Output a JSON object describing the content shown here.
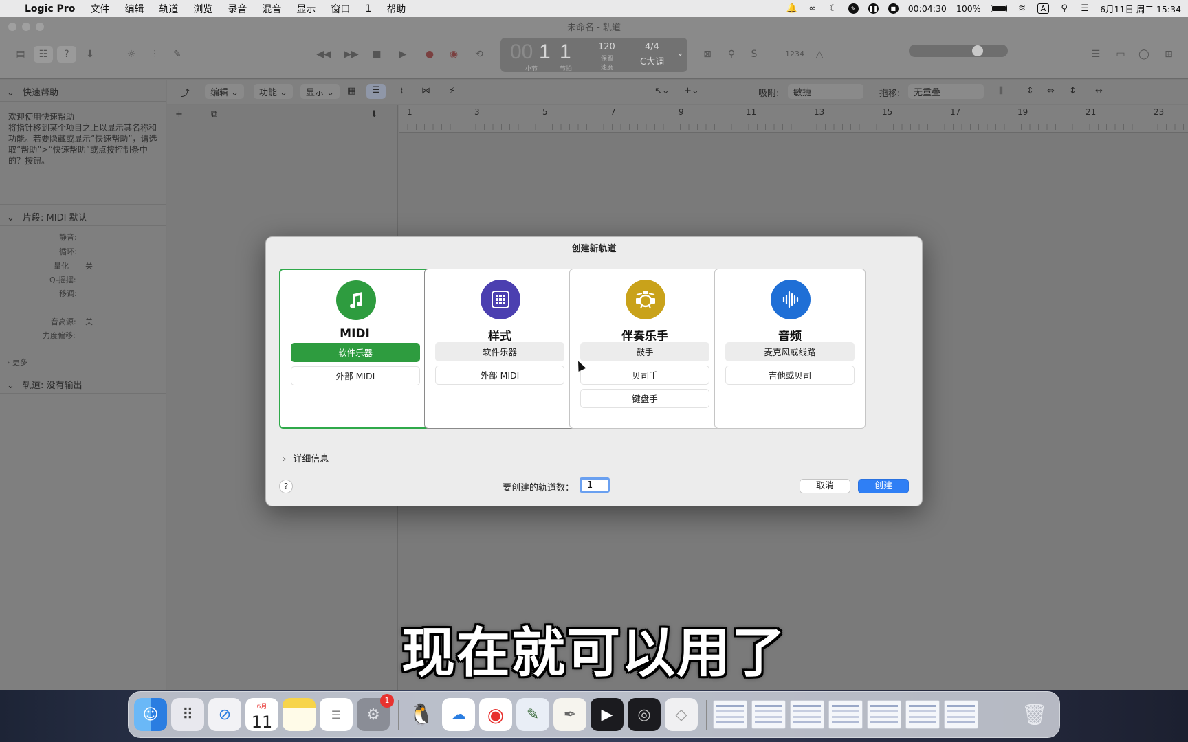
{
  "menubar": {
    "app": "Logic Pro",
    "items": [
      "文件",
      "编辑",
      "轨道",
      "浏览",
      "录音",
      "混音",
      "显示",
      "窗口",
      "1",
      "帮助"
    ],
    "recording_time": "00:04:30",
    "battery": "100%",
    "datetime": "6月11日 周二  15:34"
  },
  "window": {
    "title": "未命名 - 轨道",
    "lcd": {
      "bar": "1",
      "beat": "1",
      "bar_label": "小节",
      "beat_label": "节拍",
      "tempo": "120",
      "tempo_label": "保留",
      "speed_label": "速度",
      "signature": "4/4",
      "key": "C大调"
    },
    "counter_icon": "1234"
  },
  "inspector": {
    "quick_help_title": "快速帮助",
    "help_heading": "欢迎使用快速帮助",
    "help_body": "将指针移到某个项目之上以显示其名称和功能。若要隐藏或显示“快速帮助”，请选取“帮助”>“快速帮助”或点按控制条中的？按钮。",
    "region_title": "片段:  MIDI 默认",
    "params": {
      "mute": "静音:",
      "loop": "循环:",
      "quantize": "量化",
      "quantize_value": "关",
      "q_swing": "Q-摇摆:",
      "transpose": "移调:",
      "pitch": "音高源:",
      "pitch_value": "关",
      "velocity": "力度偏移:"
    },
    "more": "更多",
    "track_title": "轨道:  没有输出"
  },
  "main_toolbar": {
    "edit": "编辑",
    "functions": "功能",
    "view": "显示",
    "snap_label": "吸附:",
    "snap_value": "敏捷",
    "drag_label": "拖移:",
    "drag_value": "无重叠"
  },
  "ruler": {
    "marks": [
      "1",
      "3",
      "5",
      "7",
      "9",
      "11",
      "13",
      "15",
      "17",
      "19",
      "21",
      "23"
    ]
  },
  "dialog": {
    "title": "创建新轨道",
    "cards": [
      {
        "title": "MIDI",
        "options": [
          "软件乐器",
          "外部 MIDI"
        ]
      },
      {
        "title": "样式",
        "options": [
          "软件乐器",
          "外部 MIDI"
        ]
      },
      {
        "title": "伴奏乐手",
        "options": [
          "鼓手",
          "贝司手",
          "键盘手"
        ]
      },
      {
        "title": "音频",
        "options": [
          "麦克风或线路",
          "吉他或贝司"
        ]
      }
    ],
    "details": "详细信息",
    "help": "?",
    "count_label": "要创建的轨道数：",
    "count_value": "1",
    "cancel": "取消",
    "create": "创建"
  },
  "subtitle": "现在就可以用了",
  "dock": {
    "calendar_month": "6月",
    "calendar_day": "11",
    "settings_badge": "1"
  },
  "colors": {
    "midi_green": "#2e9c3f",
    "pattern_purple": "#4b3fb0",
    "session_gold": "#c9a21a",
    "audio_blue": "#1f6fd6",
    "create_blue": "#2f7ff5"
  }
}
